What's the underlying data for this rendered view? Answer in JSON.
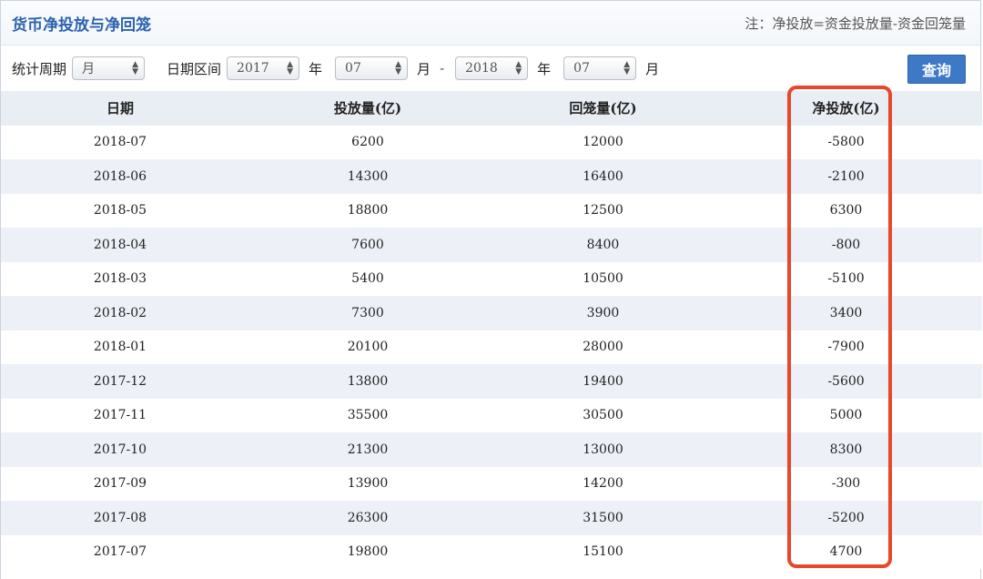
{
  "header": {
    "title": "货币净投放与净回笼",
    "note": "注：净投放=资金投放量-资金回笼量"
  },
  "filters": {
    "period_label": "统计周期",
    "period_value": "月",
    "range_label": "日期区间",
    "start_year": "2017",
    "year_unit": "年",
    "start_month": "07",
    "month_unit": "月",
    "separator": "-",
    "end_year": "2018",
    "end_month": "07",
    "query_label": "查询"
  },
  "table": {
    "columns": [
      "日期",
      "投放量(亿)",
      "回笼量(亿)",
      "净投放(亿)"
    ],
    "rows": [
      [
        "2018-07",
        "6200",
        "12000",
        "-5800"
      ],
      [
        "2018-06",
        "14300",
        "16400",
        "-2100"
      ],
      [
        "2018-05",
        "18800",
        "12500",
        "6300"
      ],
      [
        "2018-04",
        "7600",
        "8400",
        "-800"
      ],
      [
        "2018-03",
        "5400",
        "10500",
        "-5100"
      ],
      [
        "2018-02",
        "7300",
        "3900",
        "3400"
      ],
      [
        "2018-01",
        "20100",
        "28000",
        "-7900"
      ],
      [
        "2017-12",
        "13800",
        "19400",
        "-5600"
      ],
      [
        "2017-11",
        "35500",
        "30500",
        "5000"
      ],
      [
        "2017-10",
        "21300",
        "13000",
        "8300"
      ],
      [
        "2017-09",
        "13900",
        "14200",
        "-300"
      ],
      [
        "2017-08",
        "26300",
        "31500",
        "-5200"
      ],
      [
        "2017-07",
        "19800",
        "15100",
        "4700"
      ]
    ]
  },
  "colors": {
    "title": "#2a63b0",
    "button": "#3d79c7",
    "highlight": "#e8472a",
    "stripe": "#edf1f7"
  }
}
